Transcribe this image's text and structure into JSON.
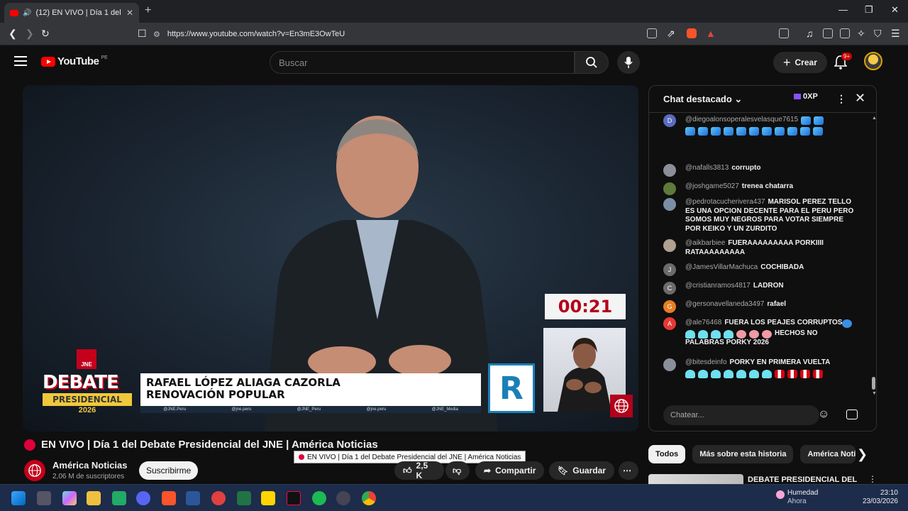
{
  "browser": {
    "tab_title": "(12) EN VIVO | Día 1 del D",
    "url": "https://www.youtube.com/watch?v=En3mE3OwTeU",
    "new_tab": "+"
  },
  "youtube": {
    "logo_text": "YouTube",
    "country_code": "PE",
    "search_placeholder": "Buscar",
    "create_label": "Crear",
    "notification_badge": "9+"
  },
  "video": {
    "timer": "00:21",
    "debate_logo": {
      "org": "JNE",
      "line1": "DEBATE",
      "line2": "PRESIDENCIAL",
      "year": "2026"
    },
    "nameplate": {
      "name": "RAFAEL LÓPEZ ALIAGA CAZORLA",
      "party": "RENOVACIÓN POPULAR"
    },
    "socials": [
      "@JNE.Peru",
      "@jne.peru",
      "@JNE_Peru",
      "@jne.peru",
      "@JNE_Media"
    ],
    "party_logo_letter": "R",
    "title": "EN VIVO | Día 1 del Debate Presidencial del JNE | América Noticias",
    "tooltip": "EN VIVO | Día 1 del Debate Presidencial del JNE | América Noticias",
    "channel": "América Noticias",
    "subscribers": "2,06 M de suscriptores",
    "subscribe_label": "Suscribirme",
    "likes": "2,5 K",
    "share_label": "Compartir",
    "save_label": "Guardar"
  },
  "chat": {
    "header": "Chat destacado",
    "xp": "0XP",
    "input_placeholder": "Chatear...",
    "messages": [
      {
        "author": "@diegoalonsoperalesvelasque7615",
        "text": "",
        "avatar_letter": "D",
        "avatar_color": "#5c6bc0"
      },
      {
        "author": "@nafalls3813",
        "text": "corrupto",
        "avatar_letter": "",
        "avatar_color": "#8a8f99"
      },
      {
        "author": "@joshgame5027",
        "text": "trenea chatarra",
        "avatar_letter": "",
        "avatar_color": "#5d7a3a"
      },
      {
        "author": "@pedrotacucherivera437",
        "text": "MARISOL PEREZ TELLO ES UNA OPCION DECENTE PARA EL PERU PERO SOMOS MUY NEGROS PARA VOTAR SIEMPRE POR KEIKO Y UN ZURDITO",
        "avatar_letter": "",
        "avatar_color": "#7a8ea6"
      },
      {
        "author": "@aikbarbiee",
        "text": "FUERAAAAAAAAA PORKIIII RATAAAAAAAAA",
        "avatar_letter": "",
        "avatar_color": "#b0a090"
      },
      {
        "author": "@JamesVillarMachuca",
        "text": "COCHIBADA",
        "avatar_letter": "J",
        "avatar_color": "#6b6b6b"
      },
      {
        "author": "@cristianramos4817",
        "text": "LADRON",
        "avatar_letter": "C",
        "avatar_color": "#6b6b6b"
      },
      {
        "author": "@gersonavellaneda3497",
        "text": "rafael",
        "avatar_letter": "G",
        "avatar_color": "#e67e22"
      },
      {
        "author": "@ale76468",
        "text": "FUERA LOS PEAJES CORRUPTOS",
        "text2": "HECHOS NO PALABRAS PORKY 2026",
        "avatar_letter": "A",
        "avatar_color": "#e53935"
      },
      {
        "author": "@bitesdeinfo",
        "text": "PORKY EN PRIMERA VUELTA",
        "avatar_letter": "",
        "avatar_color": "#8a8f99"
      }
    ]
  },
  "chips": [
    "Todos",
    "Más sobre esta historia",
    "América Notí"
  ],
  "recommended_title": "DEBATE PRESIDENCIAL DEL",
  "taskbar": {
    "weather_label": "Humedad",
    "weather_sub": "Ahora",
    "time": "23:10",
    "date": "23/03/2026"
  },
  "colors": {
    "brand_red": "#ff0000",
    "live_dot": "#e0003c",
    "timer_red": "#b3001b",
    "party_blue": "#1a7fb8"
  }
}
